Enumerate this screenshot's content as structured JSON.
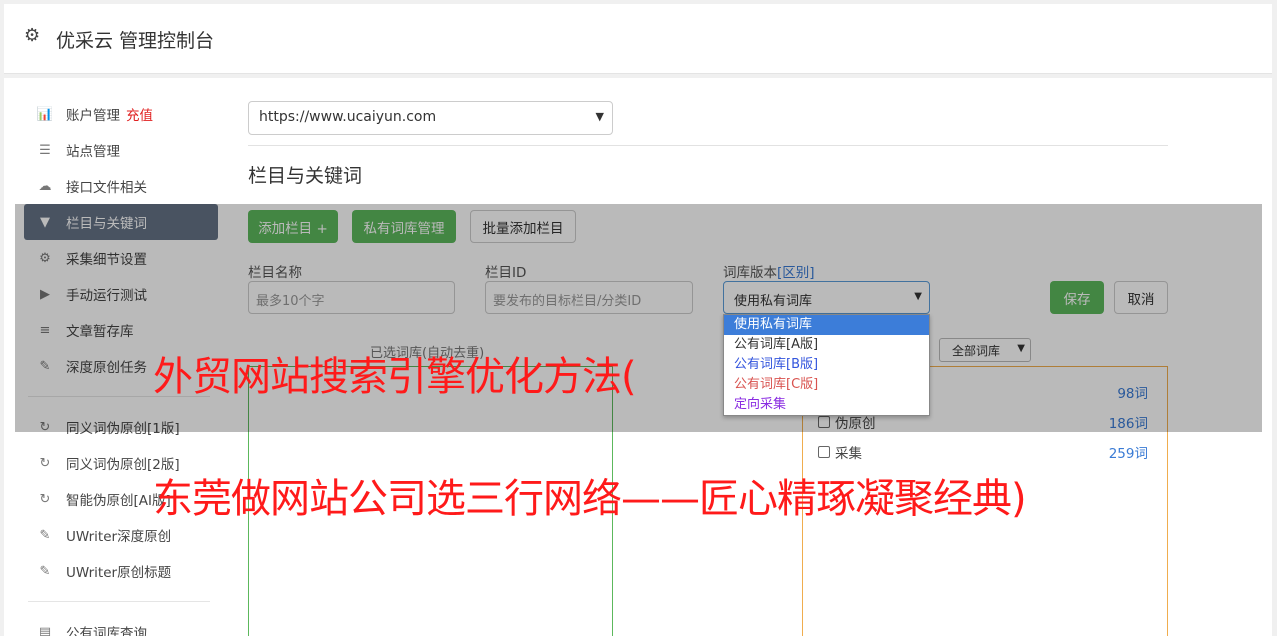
{
  "header": {
    "title": "优采云 管理控制台",
    "icon": "gear-icon"
  },
  "sidebar": {
    "items": [
      {
        "label": "账户管理",
        "extra": "充值",
        "icon": "bar-chart-icon",
        "glyph": "📊"
      },
      {
        "label": "站点管理",
        "icon": "server-icon",
        "glyph": "☰"
      },
      {
        "label": "接口文件相关",
        "icon": "cloud-upload-icon",
        "glyph": "☁"
      },
      {
        "label": "栏目与关键词",
        "icon": "filter-icon",
        "glyph": "▼",
        "active": true
      },
      {
        "label": "采集细节设置",
        "icon": "cogs-icon",
        "glyph": "⚙"
      },
      {
        "label": "手动运行测试",
        "icon": "play-circle-icon",
        "glyph": "▶"
      },
      {
        "label": "文章暂存库",
        "icon": "database-icon",
        "glyph": "≡"
      },
      {
        "label": "深度原创任务",
        "icon": "edit-icon",
        "glyph": "✎"
      },
      {
        "label": "同义词伪原创[1版]",
        "icon": "refresh-icon",
        "glyph": "↻"
      },
      {
        "label": "同义词伪原创[2版]",
        "icon": "refresh-icon",
        "glyph": "↻"
      },
      {
        "label": "智能伪原创[AI版]",
        "icon": "refresh-icon",
        "glyph": "↻"
      },
      {
        "label": "UWriter深度原创",
        "icon": "edit-icon",
        "glyph": "✎"
      },
      {
        "label": "UWriter原创标题",
        "icon": "edit-icon",
        "glyph": "✎"
      },
      {
        "label": "公有词库查询",
        "icon": "book-icon",
        "glyph": "▤"
      }
    ]
  },
  "main": {
    "site_select": "https://www.ucaiyun.com",
    "section_title": "栏目与关键词",
    "buttons": {
      "add_column": "添加栏目 +",
      "private_lib": "私有词库管理",
      "batch_add": "批量添加栏目",
      "save": "保存",
      "cancel": "取消"
    },
    "form": {
      "name_label": "栏目名称",
      "name_placeholder": "最多10个字",
      "id_label": "栏目ID",
      "id_placeholder": "要发布的目标栏目/分类ID",
      "version_label": "词库版本",
      "version_diff": "[区别]",
      "version_value": "使用私有词库"
    },
    "version_options": [
      {
        "label": "使用私有词库",
        "color": "#ffffff"
      },
      {
        "label": "公有词库[A版]",
        "color": "#333333"
      },
      {
        "label": "公有词库[B版]",
        "color": "#3355dd"
      },
      {
        "label": "公有词库[C版]",
        "color": "#d9534f"
      },
      {
        "label": "定向采集",
        "color": "#8a2be2"
      }
    ],
    "box_caption": "已选词库(自动去重)",
    "lib_filter": "全部词库",
    "lib_rows": [
      {
        "label": "",
        "count": "98词"
      },
      {
        "label": "伪原创",
        "count": "186词"
      },
      {
        "label": "采集",
        "count": "259词"
      }
    ]
  },
  "banner": {
    "line1": "外贸网站搜索引擎优化方法(",
    "line2": "东莞做网站公司选三行网络——匠心精琢凝聚经典)"
  }
}
